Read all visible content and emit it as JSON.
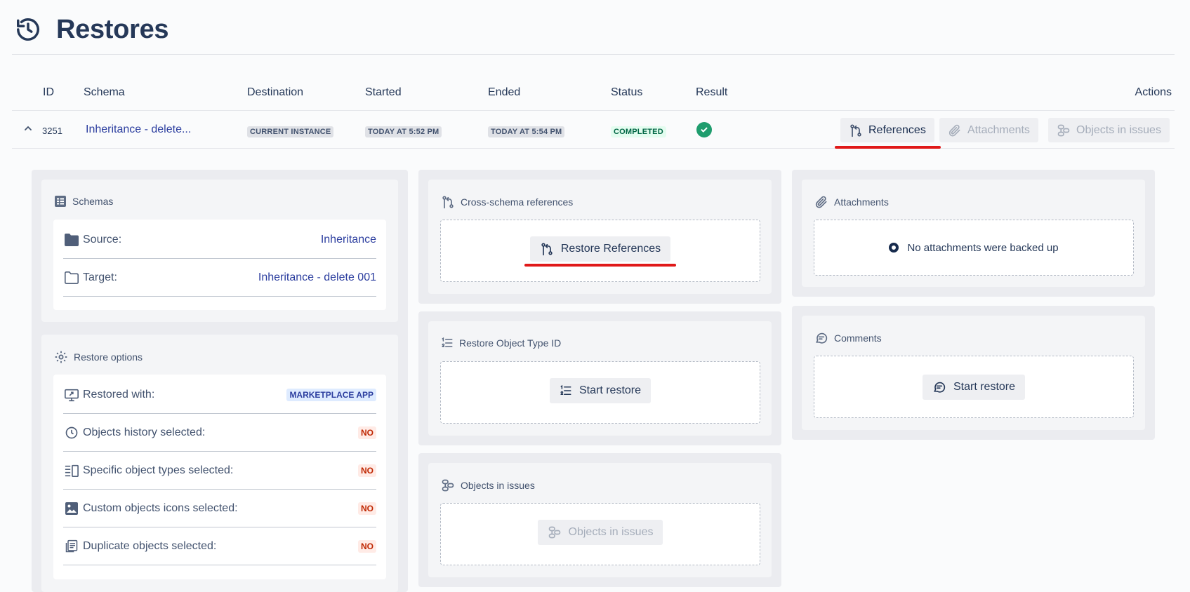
{
  "page": {
    "title": "Restores"
  },
  "table": {
    "headers": {
      "id": "ID",
      "schema": "Schema",
      "destination": "Destination",
      "started": "Started",
      "ended": "Ended",
      "status": "Status",
      "result": "Result",
      "actions": "Actions"
    },
    "row": {
      "id": "3251",
      "schema": "Inheritance - delete...",
      "destination": "CURRENT INSTANCE",
      "started": "TODAY AT 5:52 PM",
      "ended": "TODAY AT 5:54 PM",
      "status": "COMPLETED",
      "actions": {
        "references": "References",
        "attachments": "Attachments",
        "objects_in_issues": "Objects in issues"
      }
    }
  },
  "schemas": {
    "title": "Schemas",
    "source_label": "Source:",
    "source_value": "Inheritance",
    "target_label": "Target:",
    "target_value": "Inheritance - delete 001"
  },
  "restore_options": {
    "title": "Restore options",
    "items": [
      {
        "label": "Restored with:",
        "value": "MARKETPLACE APP"
      },
      {
        "label": "Objects history selected:",
        "value": "NO"
      },
      {
        "label": "Specific object types selected:",
        "value": "NO"
      },
      {
        "label": "Custom objects icons selected:",
        "value": "NO"
      },
      {
        "label": "Duplicate objects selected:",
        "value": "NO"
      }
    ]
  },
  "cross_schema": {
    "title": "Cross-schema references",
    "button": "Restore References"
  },
  "object_type_id": {
    "title": "Restore Object Type ID",
    "button": "Start restore"
  },
  "objects_in_issues": {
    "title": "Objects in issues",
    "button": "Objects in issues"
  },
  "attachments": {
    "title": "Attachments",
    "empty": "No attachments were backed up"
  },
  "comments": {
    "title": "Comments",
    "button": "Start restore"
  },
  "colors": {
    "accent_link": "#2c3e9f",
    "success": "#1f9d6e",
    "highlight": "#e01919"
  }
}
